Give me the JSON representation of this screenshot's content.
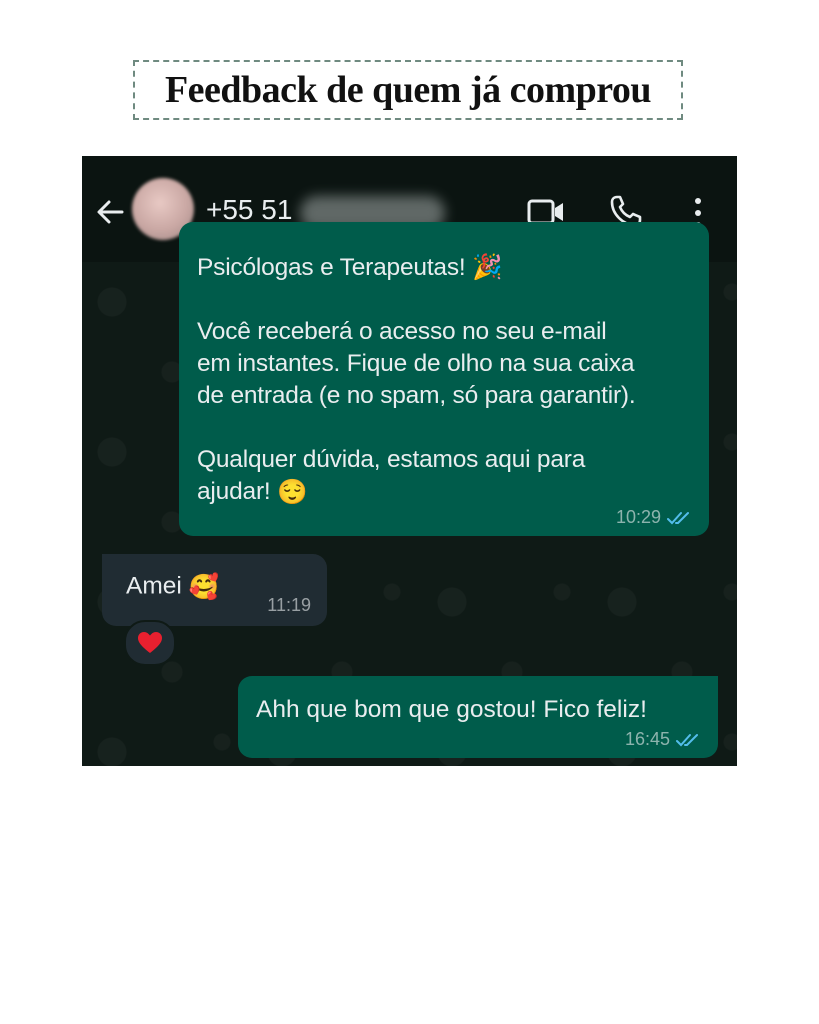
{
  "page_title": "Feedback de quem já comprou",
  "chat": {
    "contact_name": "+55 51",
    "messages": [
      {
        "direction": "outgoing",
        "lines": [
          "Psicólogas e Terapeutas! 🎉",
          "",
          "Você receberá o acesso no seu e-mail",
          "em instantes. Fique de olho na sua caixa",
          "de entrada (e no spam, só para garantir).",
          "",
          "Qualquer dúvida, estamos aqui para",
          "ajudar!"
        ],
        "emoji": "😌",
        "time": "10:29"
      },
      {
        "direction": "incoming",
        "text": "Amei",
        "emoji": "🥰",
        "time": "11:19",
        "reaction": "❤️"
      },
      {
        "direction": "outgoing",
        "text": "Ahh que bom que gostou! Fico feliz!",
        "time": "16:45"
      }
    ]
  },
  "colors": {
    "outgoing_bubble": "#005c4b",
    "incoming_bubble": "#202c33",
    "read_ticks": "#53bdeb",
    "title_border": "#6f8a80"
  },
  "icons": [
    "back-arrow-icon",
    "video-call-icon",
    "phone-icon",
    "more-vertical-icon",
    "read-ticks-icon"
  ]
}
